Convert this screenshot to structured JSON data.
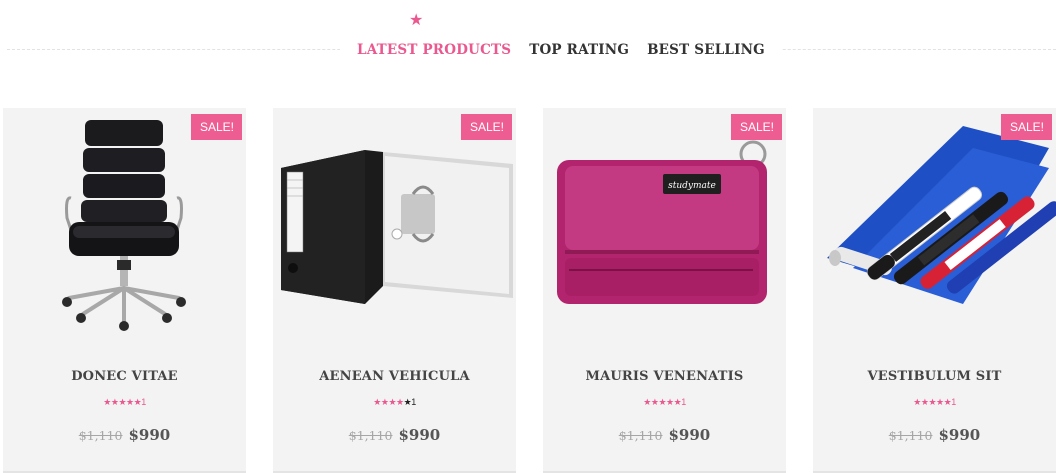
{
  "tabs": [
    {
      "label": "LATEST PRODUCTS",
      "active": true
    },
    {
      "label": "TOP RATING",
      "active": false
    },
    {
      "label": "BEST SELLING",
      "active": false
    }
  ],
  "products": [
    {
      "name": "DONEC VITAE",
      "badge": "SALE!",
      "old_price": "$1,110",
      "price": "$990",
      "rating_count": "1",
      "stars_filled": 5,
      "image": "office-chair"
    },
    {
      "name": "AENEAN VEHICULA",
      "badge": "SALE!",
      "old_price": "$1,110",
      "price": "$990",
      "rating_count": "1",
      "stars_filled": 4,
      "image": "ring-binder"
    },
    {
      "name": "MAURIS VENENATIS",
      "badge": "SALE!",
      "old_price": "$1,110",
      "price": "$990",
      "rating_count": "1",
      "stars_filled": 5,
      "image": "pencil-pouch",
      "image_label": "studymate"
    },
    {
      "name": "VESTIBULUM SIT",
      "badge": "SALE!",
      "old_price": "$1,110",
      "price": "$990",
      "rating_count": "1",
      "stars_filled": 5,
      "image": "markers-and-rolls"
    }
  ],
  "colors": {
    "accent": "#e9588f",
    "card_bg": "#f3f3f3",
    "sale_badge": "#ee5d91"
  }
}
